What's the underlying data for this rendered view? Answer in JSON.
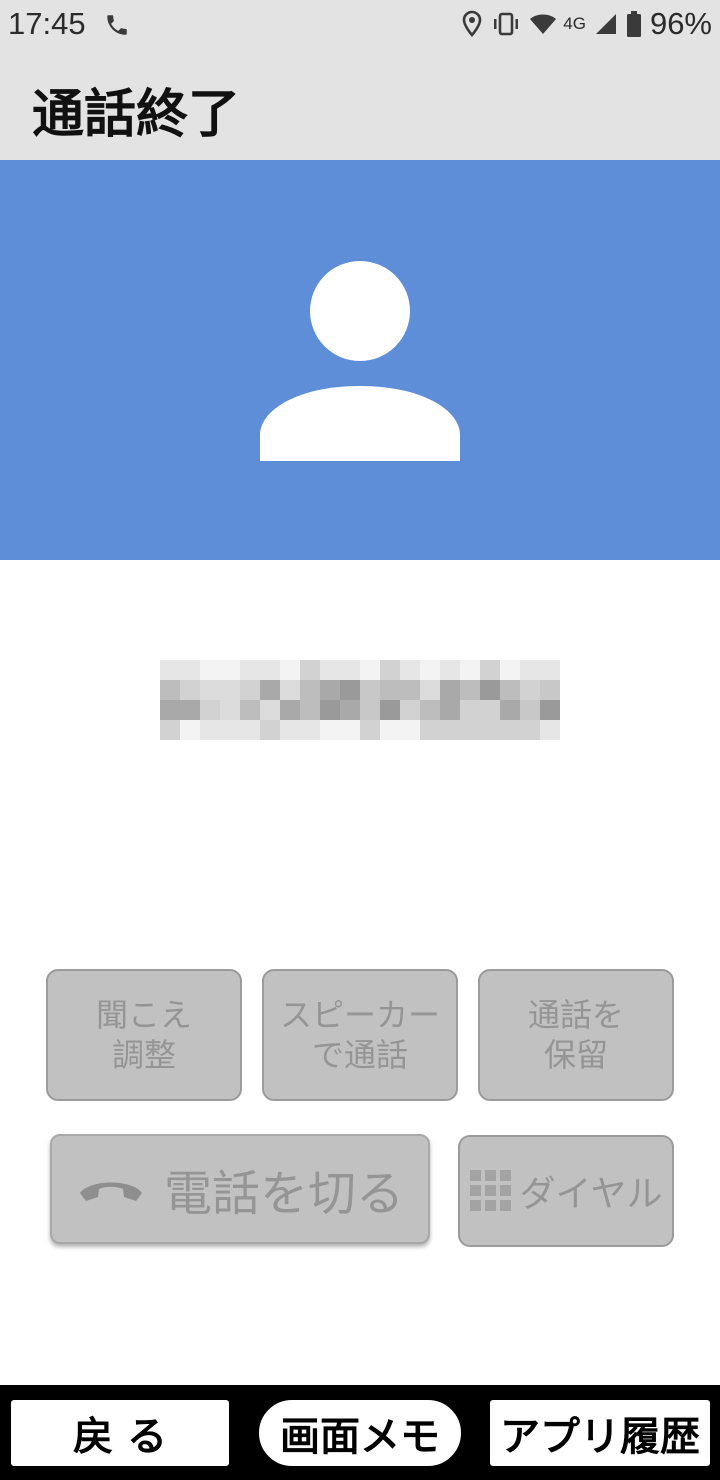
{
  "status_bar": {
    "time": "17:45",
    "network": "4G",
    "battery": "96%"
  },
  "app_bar": {
    "title": "通話終了"
  },
  "contact": {
    "avatar_icon": "person-icon"
  },
  "controls": {
    "volume_label": "聞こえ\n調整",
    "speaker_label": "スピーカー\nで通話",
    "hold_label": "通話を\n保留",
    "hangup_label": "電話を切る",
    "dial_label": "ダイヤル"
  },
  "nav": {
    "back_label": "戻 る",
    "memo_label": "画面メモ",
    "history_label": "アプリ履歴"
  },
  "colors": {
    "banner": "#5f8ed9",
    "disabled_button": "#c1c1c1",
    "disabled_text": "#959595",
    "bar_background": "#e3e3e3"
  }
}
